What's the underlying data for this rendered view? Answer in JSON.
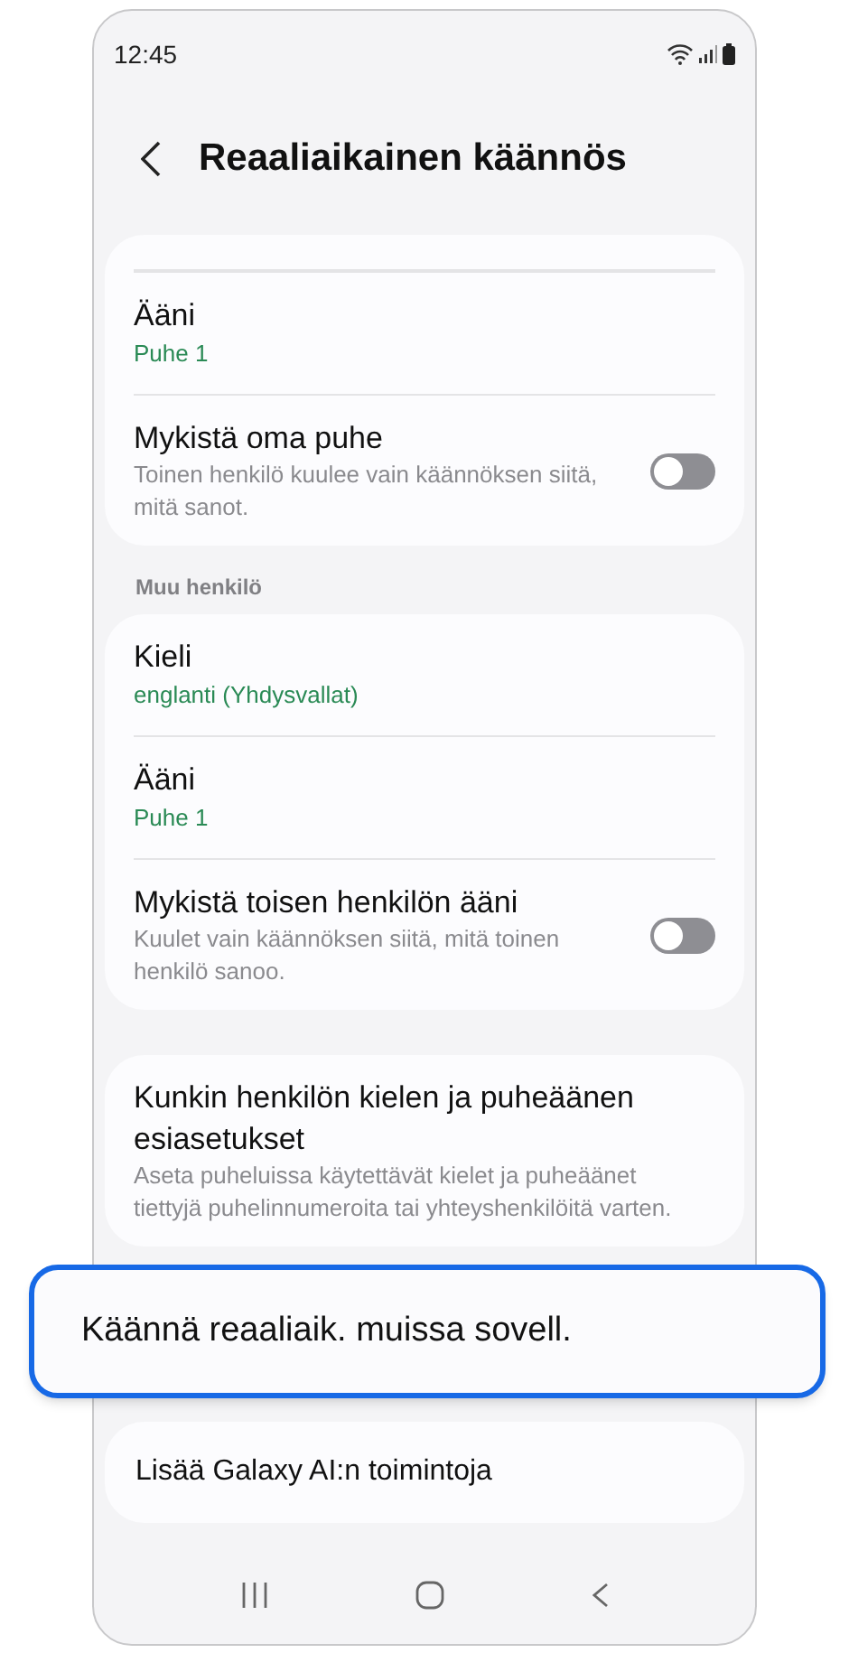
{
  "status_bar": {
    "time": "12:45"
  },
  "header": {
    "title": "Reaaliaikainen käännös"
  },
  "sections": [
    {
      "items": [
        {
          "kind": "value",
          "title": "Ääni",
          "value": "Puhe 1"
        },
        {
          "kind": "toggle",
          "title": "Mykistä oma puhe",
          "description": "Toinen henkilö kuulee vain käännöksen siitä, mitä sanot.",
          "on": false
        }
      ]
    },
    {
      "header": "Muu henkilö",
      "items": [
        {
          "kind": "value",
          "title": "Kieli",
          "value": "englanti (Yhdysvallat)"
        },
        {
          "kind": "value",
          "title": "Ääni",
          "value": "Puhe 1"
        },
        {
          "kind": "toggle",
          "title": "Mykistä toisen henkilön ääni",
          "description": "Kuulet vain käännöksen siitä, mitä toinen henkilö sanoo.",
          "on": false
        }
      ]
    },
    {
      "items": [
        {
          "kind": "link",
          "title": "Kunkin henkilön kielen ja puheäänen esiasetukset",
          "description": "Aseta puheluissa käytettävät kielet ja puheäänet tiettyjä puhelinnumeroita tai yhteyshenkilöitä varten."
        }
      ]
    }
  ],
  "highlighted_item": {
    "title": "Käännä reaaliaik. muissa sovell."
  },
  "more_item": {
    "title": "Lisää Galaxy AI:n toimintoja"
  }
}
